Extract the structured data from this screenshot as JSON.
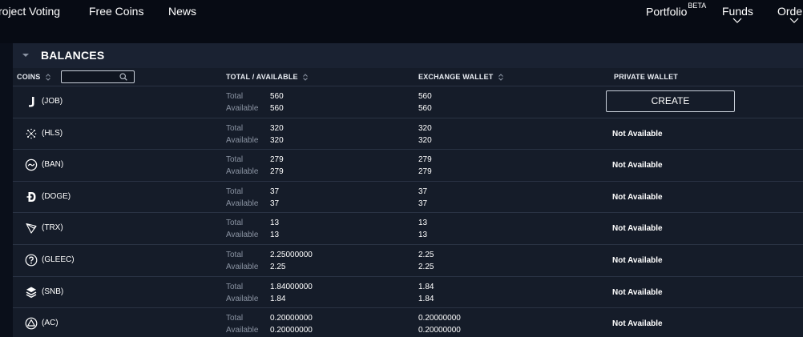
{
  "nav": {
    "items": [
      {
        "label": "roject Voting"
      },
      {
        "label": "Free Coins"
      },
      {
        "label": "News"
      }
    ],
    "portfolio": {
      "label": "Portfolio",
      "badge": "BETA"
    },
    "funds": {
      "label": "Funds"
    },
    "orders": {
      "label": "Orders"
    }
  },
  "panel": {
    "title": "BALANCES",
    "columns": {
      "coins": "COINS",
      "total_available": "TOTAL / AVAILABLE",
      "exchange_wallet": "EXCHANGE WALLET",
      "private_wallet": "PRIVATE WALLET"
    },
    "search": {
      "value": "",
      "placeholder": ""
    }
  },
  "labels": {
    "total": "Total",
    "available": "Available"
  },
  "rows": [
    {
      "coin": "(JOB)",
      "icon": "job-icon",
      "total": "560",
      "available": "560",
      "ex_total": "560",
      "ex_available": "560",
      "private": "CREATE"
    },
    {
      "coin": "(HLS)",
      "icon": "hls-icon",
      "total": "320",
      "available": "320",
      "ex_total": "320",
      "ex_available": "320",
      "private": "Not Available"
    },
    {
      "coin": "(BAN)",
      "icon": "ban-icon",
      "total": "279",
      "available": "279",
      "ex_total": "279",
      "ex_available": "279",
      "private": "Not Available"
    },
    {
      "coin": "(DOGE)",
      "icon": "doge-icon",
      "total": "37",
      "available": "37",
      "ex_total": "37",
      "ex_available": "37",
      "private": "Not Available"
    },
    {
      "coin": "(TRX)",
      "icon": "trx-icon",
      "total": "13",
      "available": "13",
      "ex_total": "13",
      "ex_available": "13",
      "private": "Not Available"
    },
    {
      "coin": "(GLEEC)",
      "icon": "gleec-icon",
      "total": "2.25000000",
      "available": "2.25",
      "ex_total": "2.25",
      "ex_available": "2.25",
      "private": "Not Available"
    },
    {
      "coin": "(SNB)",
      "icon": "snb-icon",
      "total": "1.84000000",
      "available": "1.84",
      "ex_total": "1.84",
      "ex_available": "1.84",
      "private": "Not Available"
    },
    {
      "coin": "(AC)",
      "icon": "ac-icon",
      "total": "0.20000000",
      "available": "0.20000000",
      "ex_total": "0.20000000",
      "ex_available": "0.20000000",
      "private": "Not Available"
    }
  ],
  "colors": {
    "background": "#0a0f1a",
    "panel": "#151c29",
    "panel_header": "#1a2232",
    "row_divider": "#2a3344",
    "muted_label": "#8b94a3"
  }
}
